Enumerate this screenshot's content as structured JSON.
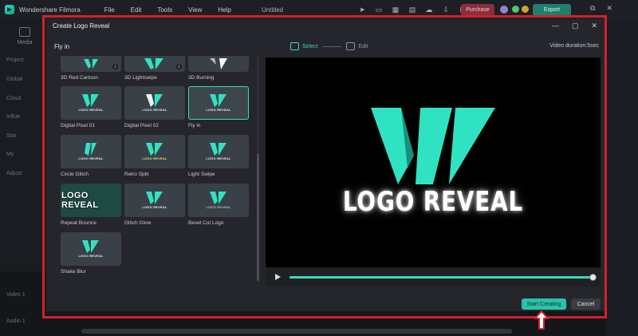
{
  "app": {
    "name": "Wondershare Filmora",
    "menu": [
      "File",
      "Edit",
      "Tools",
      "View",
      "Help"
    ],
    "document_title": "Untitled",
    "purchase_label": "Purchase",
    "export_label": "Export"
  },
  "background": {
    "media_label": "Media",
    "side_items": [
      "Project",
      "Global",
      "Cloud",
      "Influe",
      "Star",
      "My",
      "Adjust"
    ],
    "track_labels": [
      "Video 1",
      "Audio 1"
    ]
  },
  "dialog": {
    "title": "Create Logo Reveal",
    "section_label": "Fly in",
    "steps": [
      {
        "label": "Select",
        "active": true
      },
      {
        "label": "Edit",
        "active": false
      }
    ],
    "duration": "Video duration:5sec",
    "templates": [
      {
        "label": "3D Red Cartoon",
        "thumb_text": "",
        "download": true
      },
      {
        "label": "3D Lightswipe",
        "thumb_text": "",
        "download": true
      },
      {
        "label": "3D Burning",
        "thumb_text": "",
        "download": false
      },
      {
        "label": "Digital Pixel 01",
        "thumb_text": "LOGO REVEAL",
        "download": false
      },
      {
        "label": "Digital Pixel 02",
        "thumb_text": "LOGO REVEAL",
        "download": false
      },
      {
        "label": "Fly in",
        "thumb_text": "LOGO REVEAL",
        "download": false,
        "selected": true
      },
      {
        "label": "Circle Glitch",
        "thumb_text": "LOGO REVEAL",
        "download": false
      },
      {
        "label": "Retro Split",
        "thumb_text": "LOGO REVEAL",
        "download": false
      },
      {
        "label": "Light Swipe",
        "thumb_text": "LOGO REVEAL",
        "download": false
      },
      {
        "label": "Repeat Bounce",
        "thumb_text": "LOGO REVEAL",
        "download": false
      },
      {
        "label": "Glitch Glow",
        "thumb_text": "LOGO REVEAL",
        "download": false
      },
      {
        "label": "Bevel Cut Logo",
        "thumb_text": "LOGO REVEAL",
        "download": false
      },
      {
        "label": "Shake Blur",
        "thumb_text": "LOGO REVEAL",
        "download": false
      }
    ],
    "preview_text": "LOGO REVEAL",
    "progress": 1.0,
    "start_label": "Start Creating",
    "cancel_label": "Cancel"
  },
  "colors": {
    "accent": "#36d9bd",
    "highlight": "#d2212d",
    "logo_primary": "#2fe3c2",
    "logo_dark": "#168f7c"
  }
}
